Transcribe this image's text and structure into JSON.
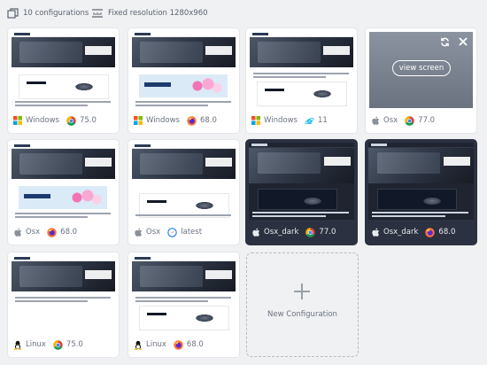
{
  "toolbar": {
    "config_count_label": "10 configurations",
    "resolution_label": "Fixed resolution 1280x960"
  },
  "configs": [
    {
      "os": "Windows",
      "os_icon": "windows-icon",
      "browser": "chrome",
      "browser_icon": "chrome-icon",
      "version": "75.0",
      "dark": false
    },
    {
      "os": "Windows",
      "os_icon": "windows-icon",
      "browser": "firefox",
      "browser_icon": "firefox-icon",
      "version": "68.0",
      "dark": false
    },
    {
      "os": "Windows",
      "os_icon": "windows-icon",
      "browser": "ie",
      "browser_icon": "internet-explorer-icon",
      "version": "11",
      "dark": false
    },
    {
      "os": "Osx",
      "os_icon": "apple-icon",
      "browser": "chrome",
      "browser_icon": "chrome-icon",
      "version": "77.0",
      "dark": false,
      "hover_action": "view screen"
    },
    {
      "os": "Osx",
      "os_icon": "apple-icon",
      "browser": "firefox",
      "browser_icon": "firefox-icon",
      "version": "68.0",
      "dark": false
    },
    {
      "os": "Osx",
      "os_icon": "apple-icon",
      "browser": "safari",
      "browser_icon": "safari-icon",
      "version": "latest",
      "dark": false
    },
    {
      "os": "Osx_dark",
      "os_icon": "apple-icon",
      "browser": "chrome",
      "browser_icon": "chrome-icon",
      "version": "77.0",
      "dark": true
    },
    {
      "os": "Osx_dark",
      "os_icon": "apple-icon",
      "browser": "firefox",
      "browser_icon": "firefox-icon",
      "version": "68.0",
      "dark": true
    },
    {
      "os": "Linux",
      "os_icon": "linux-icon",
      "browser": "chrome",
      "browser_icon": "chrome-icon",
      "version": "75.0",
      "dark": false
    },
    {
      "os": "Linux",
      "os_icon": "linux-icon",
      "browser": "firefox",
      "browser_icon": "firefox-icon",
      "version": "68.0",
      "dark": false
    }
  ],
  "new_config": {
    "label": "New Configuration"
  },
  "colors": {
    "accent_dark_card": "#2b3140",
    "background": "#f0f1f3"
  }
}
